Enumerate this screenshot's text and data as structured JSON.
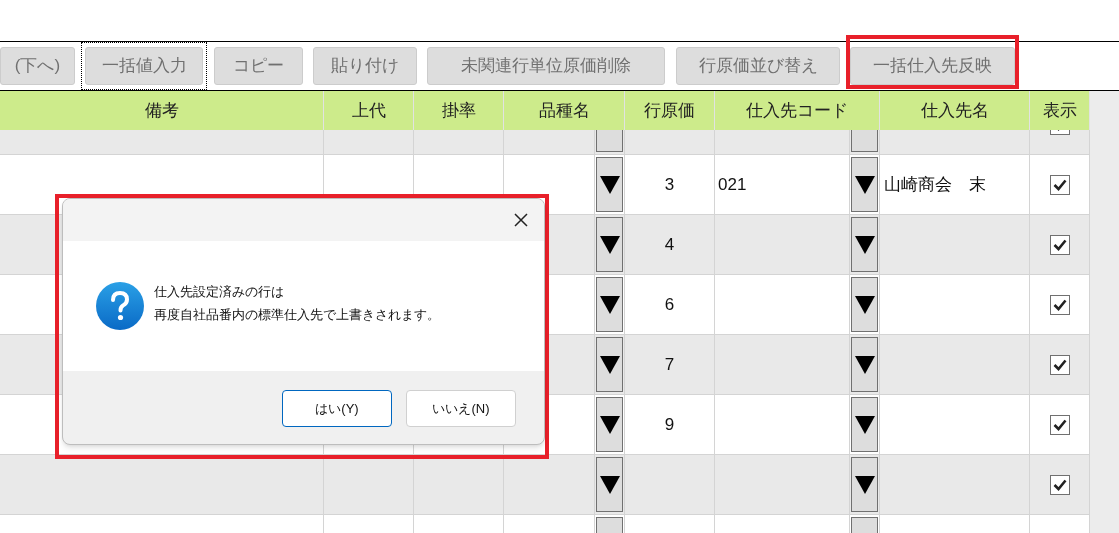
{
  "toolbar": {
    "buttons": [
      {
        "label": "(下へ)",
        "focused": false,
        "highlighted": false
      },
      {
        "label": "一括値入力",
        "focused": true,
        "highlighted": false
      },
      {
        "label": "コピー",
        "focused": false,
        "highlighted": false
      },
      {
        "label": "貼り付け",
        "focused": false,
        "highlighted": false
      },
      {
        "label": "未関連行単位原価削除",
        "focused": false,
        "highlighted": false
      },
      {
        "label": "行原価並び替え",
        "focused": false,
        "highlighted": false
      },
      {
        "label": "一括仕入先反映",
        "focused": false,
        "highlighted": true
      }
    ]
  },
  "table": {
    "columns": [
      "備考",
      "上代",
      "掛率",
      "品種名",
      "行原価",
      "仕入先コード",
      "仕入先名",
      "表示"
    ],
    "rows": [
      {
        "shown": true
      },
      {
        "line_cost": "3",
        "supplier_code": "021",
        "supplier_name": "山崎商会　末",
        "shown": true
      },
      {
        "line_cost": "4",
        "shown": true
      },
      {
        "line_cost": "6",
        "shown": true
      },
      {
        "line_cost": "7",
        "shown": true
      },
      {
        "line_cost": "9",
        "shown": true
      },
      {
        "shown": true
      },
      {}
    ]
  },
  "dialog": {
    "highlighted": true,
    "message_lines": [
      "仕入先設定済みの行は",
      "再度自社品番内の標準仕入先で上書きされます。"
    ],
    "buttons": [
      {
        "label": "はい(Y)",
        "default": true
      },
      {
        "label": "いいえ(N)",
        "default": false
      }
    ]
  }
}
